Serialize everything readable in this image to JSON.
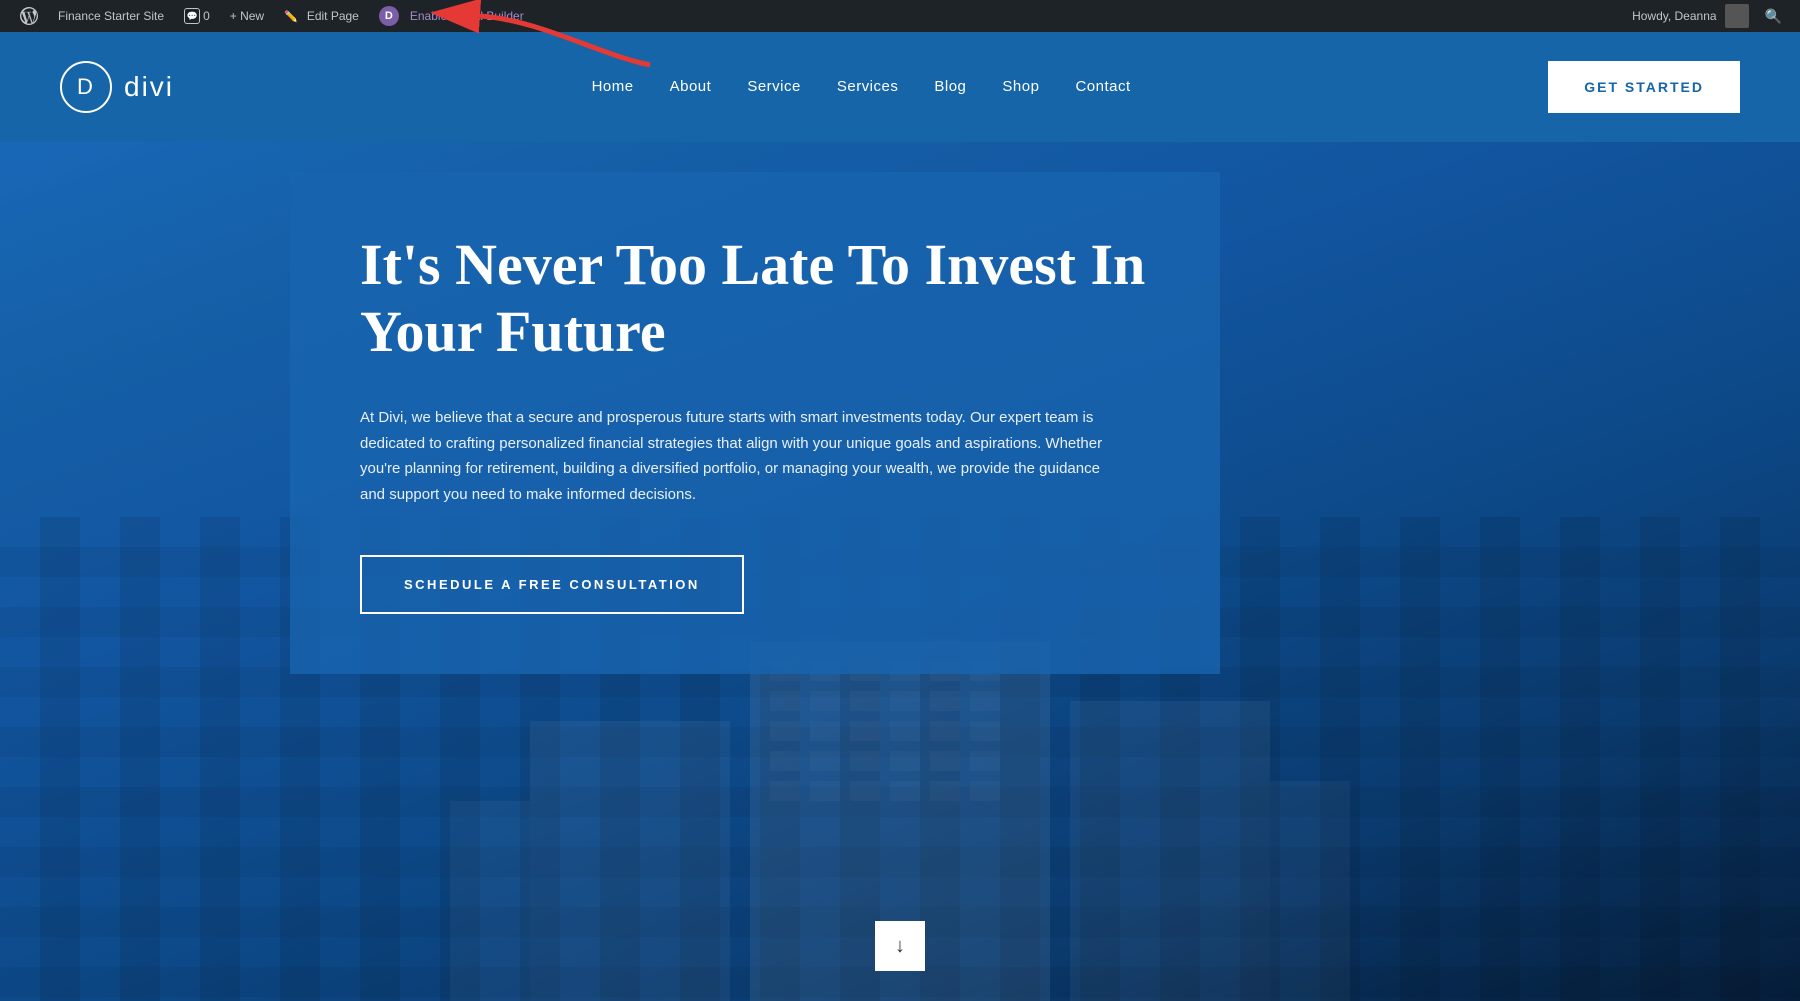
{
  "admin_bar": {
    "site_name": "Finance Starter Site",
    "comments_label": "0",
    "new_label": "+ New",
    "edit_page_label": "Edit Page",
    "enable_visual_builder_label": "Enable Visual Builder",
    "howdy_label": "Howdy, Deanna"
  },
  "nav": {
    "logo_letter": "D",
    "logo_text": "divi",
    "links": [
      {
        "label": "Home"
      },
      {
        "label": "About"
      },
      {
        "label": "Service"
      },
      {
        "label": "Services"
      },
      {
        "label": "Blog"
      },
      {
        "label": "Shop"
      },
      {
        "label": "Contact"
      }
    ],
    "cta_label": "GET STARTED"
  },
  "hero": {
    "title": "It's Never Too Late To Invest In Your Future",
    "description": "At Divi, we believe that a secure and prosperous future starts with smart investments today. Our expert team is dedicated to crafting personalized financial strategies that align with your unique goals and aspirations. Whether you're planning for retirement, building a diversified portfolio, or managing your wealth, we provide the guidance and support you need to make informed decisions.",
    "cta_label": "SCHEDULE A FREE CONSULTATION",
    "scroll_down_icon": "↓"
  },
  "colors": {
    "admin_bar_bg": "#1d2327",
    "nav_bg": "#1565a8",
    "hero_overlay": "rgba(25, 100, 175, 0.82)",
    "get_started_btn_bg": "#ffffff",
    "get_started_btn_text": "#1565a8"
  }
}
